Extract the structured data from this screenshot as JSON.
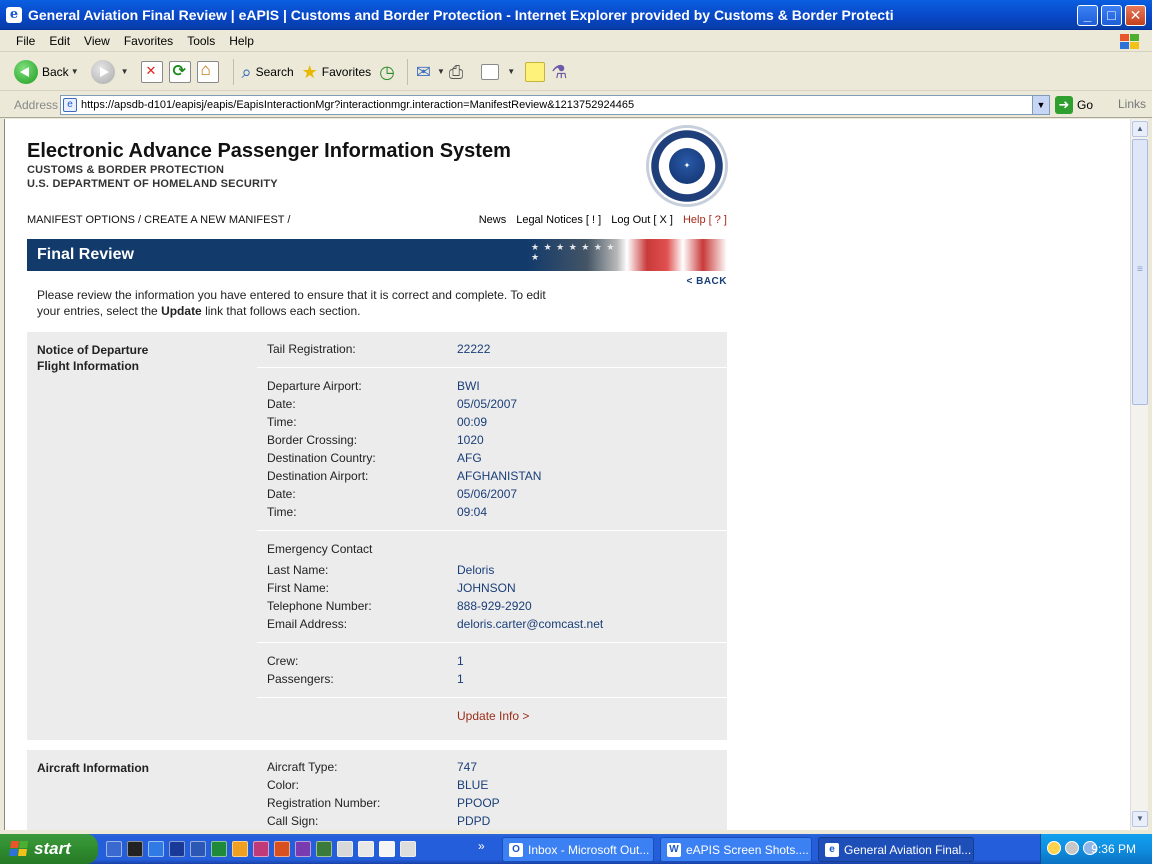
{
  "window": {
    "title": "General Aviation Final Review | eAPIS | Customs and Border Protection - Internet Explorer provided by Customs & Border Protecti",
    "min": "_",
    "max": "□",
    "close": "✕"
  },
  "menu": [
    "File",
    "Edit",
    "View",
    "Favorites",
    "Tools",
    "Help"
  ],
  "toolbar": {
    "back": "Back",
    "search": "Search",
    "favorites": "Favorites"
  },
  "address": {
    "label": "Address",
    "url": "https://apsdb-d101/eapisj/eapis/EapisInteractionMgr?interactionmgr.interaction=ManifestReview&1213752924465",
    "go": "Go",
    "links": "Links"
  },
  "header": {
    "system_title": "Electronic Advance Passenger Information System",
    "agency": "CUSTOMS & BORDER PROTECTION",
    "department": "U.S. DEPARTMENT OF HOMELAND SECURITY",
    "breadcrumb": "MANIFEST OPTIONS / CREATE A NEW MANIFEST /",
    "nav": {
      "news": "News",
      "legal": "Legal Notices [ ! ]",
      "logout": "Log Out [ X ]",
      "help": "Help [ ? ]"
    }
  },
  "banner": {
    "title": "Final Review"
  },
  "back_link": "< BACK",
  "intro": {
    "line1": "Please review the information you have entered to ensure that it is correct and complete. To edit",
    "line2_pre": "your entries, select the ",
    "line2_bold": "Update",
    "line2_post": " link that follows each section."
  },
  "departure": {
    "title_line1": "Notice of Departure",
    "title_line2": "Flight Information",
    "tail_label": "Tail Registration:",
    "tail_value": "22222",
    "flight": [
      {
        "label": "Departure Airport:",
        "value": "BWI"
      },
      {
        "label": "Date:",
        "value": "05/05/2007"
      },
      {
        "label": "Time:",
        "value": "00:09"
      },
      {
        "label": "Border Crossing:",
        "value": "1020"
      },
      {
        "label": "Destination Country:",
        "value": "AFG"
      },
      {
        "label": "Destination Airport:",
        "value": "AFGHANISTAN"
      },
      {
        "label": "Date:",
        "value": "05/06/2007"
      },
      {
        "label": "Time:",
        "value": "09:04"
      }
    ],
    "emergency_heading": "Emergency Contact",
    "contact": [
      {
        "label": "Last Name:",
        "value": "Deloris"
      },
      {
        "label": "First Name:",
        "value": "JOHNSON"
      },
      {
        "label": "Telephone Number:",
        "value": "888-929-2920"
      },
      {
        "label": "Email Address:",
        "value": "deloris.carter@comcast.net"
      }
    ],
    "counts": [
      {
        "label": "Crew:",
        "value": "1"
      },
      {
        "label": "Passengers:",
        "value": "1"
      }
    ],
    "update": "Update Info >"
  },
  "aircraft": {
    "title": "Aircraft Information",
    "rows": [
      {
        "label": "Aircraft Type:",
        "value": "747"
      },
      {
        "label": "Color:",
        "value": "BLUE"
      },
      {
        "label": "Registration Number:",
        "value": "PPOOP"
      },
      {
        "label": "Call Sign:",
        "value": "PDPD"
      }
    ]
  },
  "taskbar": {
    "start": "start",
    "more": "»",
    "tasks": [
      {
        "label": "Inbox - Microsoft Out...",
        "icon": "O"
      },
      {
        "label": "eAPIS Screen Shots....",
        "icon": "W"
      },
      {
        "label": "General Aviation Final...",
        "icon": "e"
      }
    ],
    "time": "9:36 PM"
  }
}
